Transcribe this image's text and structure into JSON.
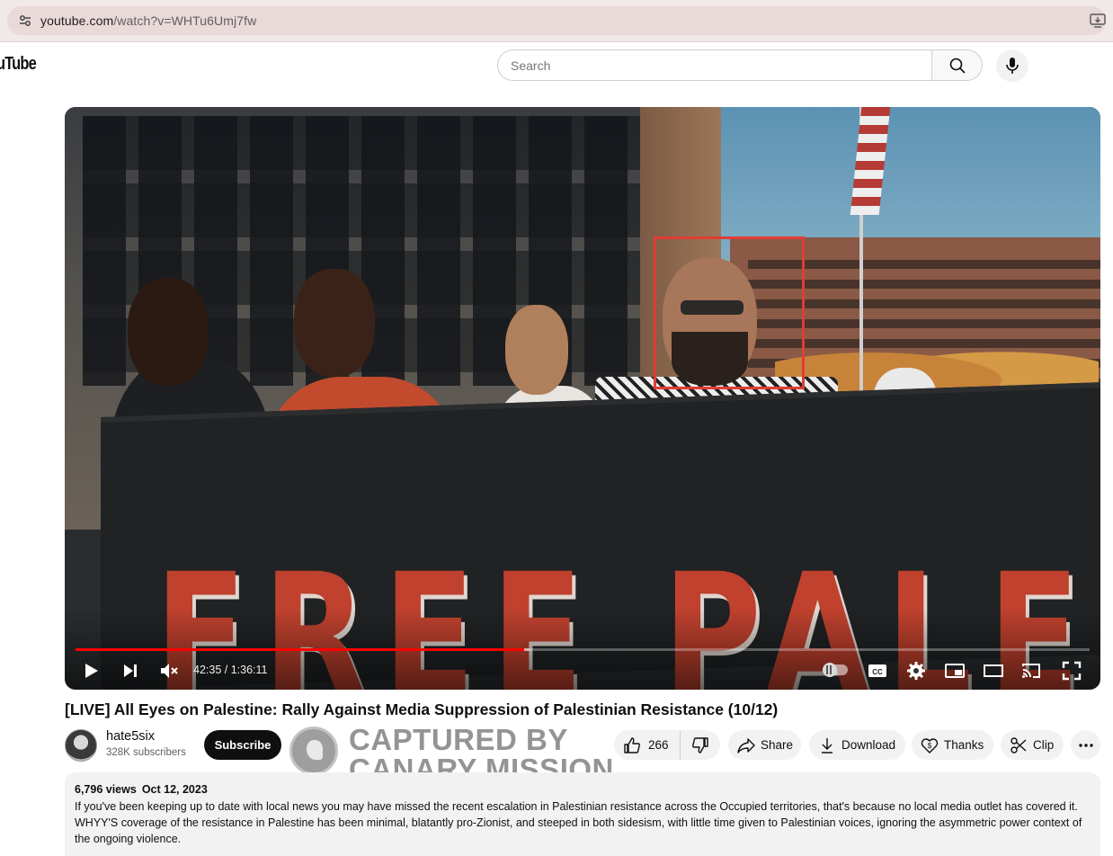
{
  "browser": {
    "url_domain": "youtube.com",
    "url_path": "/watch?v=WHTu6Umj7fw"
  },
  "header": {
    "logo_text": "uTube",
    "search_placeholder": "Search"
  },
  "player": {
    "current_time": "42:35",
    "duration": "1:36:11",
    "time_display": "42:35 / 1:36:11",
    "progress_fraction": 0.4427,
    "buffered_fraction": 0.448,
    "progress_color": "#ff0000",
    "banner_text": "FREE PALEST",
    "highlight_color": "#e03c35",
    "icons": [
      "play-icon",
      "next-icon",
      "mute-icon",
      "autoplay-toggle",
      "cc-icon",
      "settings-icon",
      "miniplayer-icon",
      "theater-icon",
      "cast-icon",
      "fullscreen-icon"
    ]
  },
  "video": {
    "title": "[LIVE] All Eyes on Palestine: Rally Against Media Suppression of Palestinian Resistance (10/12)",
    "channel_name": "hate5six",
    "subscribers": "328K subscribers",
    "subscribe_label": "Subscribe",
    "likes": "266",
    "share_label": "Share",
    "download_label": "Download",
    "thanks_label": "Thanks",
    "clip_label": "Clip"
  },
  "watermark": {
    "line1": "CAPTURED BY",
    "line2": "CANARY MISSION"
  },
  "description": {
    "views": "6,796 views",
    "date": "Oct 12, 2023",
    "text": "If you've been keeping up to date with local news you may have missed the recent escalation in Palestinian resistance across the Occupied territories, that's because no local media outlet has covered it. WHYY'S coverage of the resistance in Palestine has been minimal, blatantly pro-Zionist, and steeped in both sidesism, with little time given to Palestinian voices, ignoring the asymmetric power context of the ongoing violence."
  }
}
